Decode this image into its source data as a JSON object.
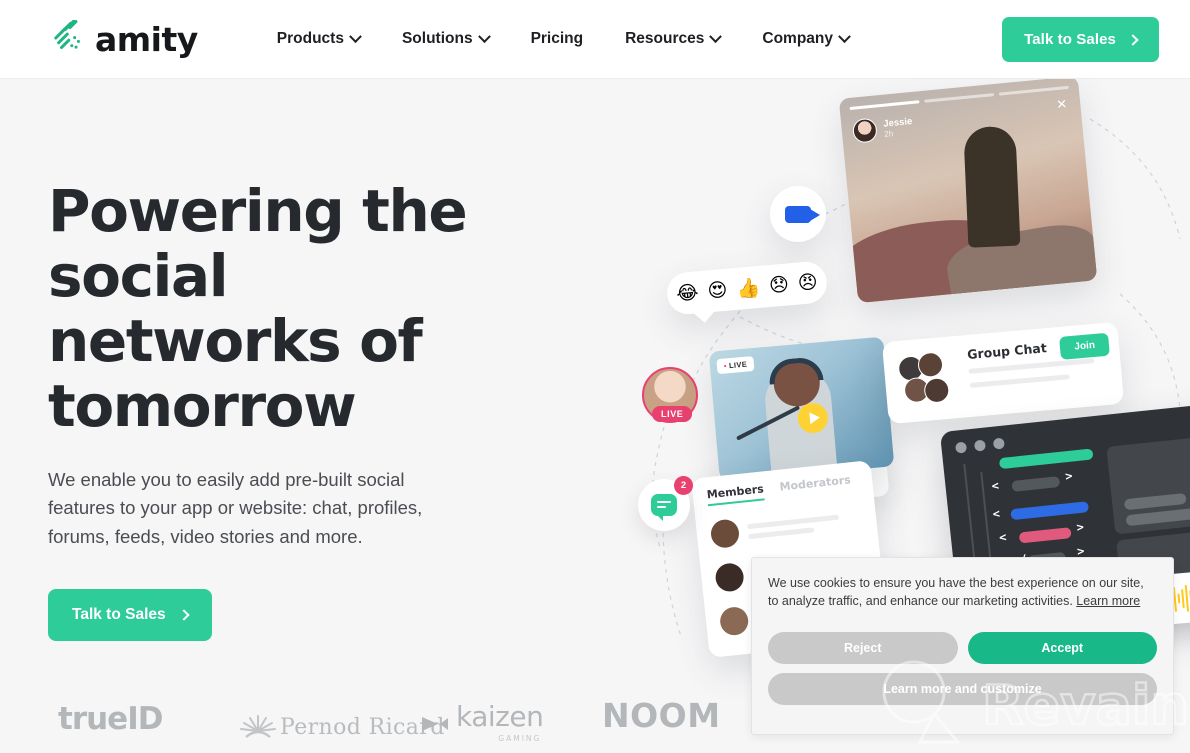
{
  "brand": {
    "name": "amity",
    "logo_icon": "amity-diamond-logo",
    "accent_green": "#2ecc98",
    "dark_text": "#26292e"
  },
  "header": {
    "nav_items": [
      {
        "label": "Products",
        "has_dropdown": true
      },
      {
        "label": "Solutions",
        "has_dropdown": true
      },
      {
        "label": "Pricing",
        "has_dropdown": false
      },
      {
        "label": "Resources",
        "has_dropdown": true
      },
      {
        "label": "Company",
        "has_dropdown": true
      }
    ],
    "cta_label": "Talk to Sales"
  },
  "hero": {
    "headline": "Powering the social\nnetworks of\ntomorrow",
    "subhead": "We enable you to easily add pre-built social features to your app or website: chat, profiles, forums, feeds, video stories and more.",
    "cta_label": "Talk to Sales"
  },
  "illustration": {
    "story": {
      "user_name": "Jessie",
      "time": "2h",
      "close_icon": "close-icon"
    },
    "video_icon": "video-camera-icon",
    "reactions": [
      "😂",
      "😍",
      "👍",
      "😞",
      "😠"
    ],
    "live_badge": "LIVE",
    "stream_badge": "LIVE",
    "group_chat": {
      "title": "Group Chat",
      "join_label": "Join"
    },
    "members_card": {
      "tab_active": "Members",
      "tab_inactive": "Moderators"
    },
    "chat_badge_count": "2",
    "mic_icon": "microphone-icon",
    "waveform_icon": "audio-waveform"
  },
  "cookie_banner": {
    "message_part1": "We use cookies to ensure you have the best experience on our site, to analyze traffic, and enhance our marketing activities. ",
    "learn_more_link": "Learn more",
    "reject_label": "Reject",
    "accept_label": "Accept",
    "customize_label": "Learn more and customize",
    "accept_color": "#19b889"
  },
  "client_logos": [
    {
      "name": "trueID"
    },
    {
      "name": "Pernod Ricard"
    },
    {
      "name": "kaizen",
      "sub": "GAMING"
    },
    {
      "name": "NOOM"
    }
  ],
  "watermark": {
    "text": "Revain"
  }
}
